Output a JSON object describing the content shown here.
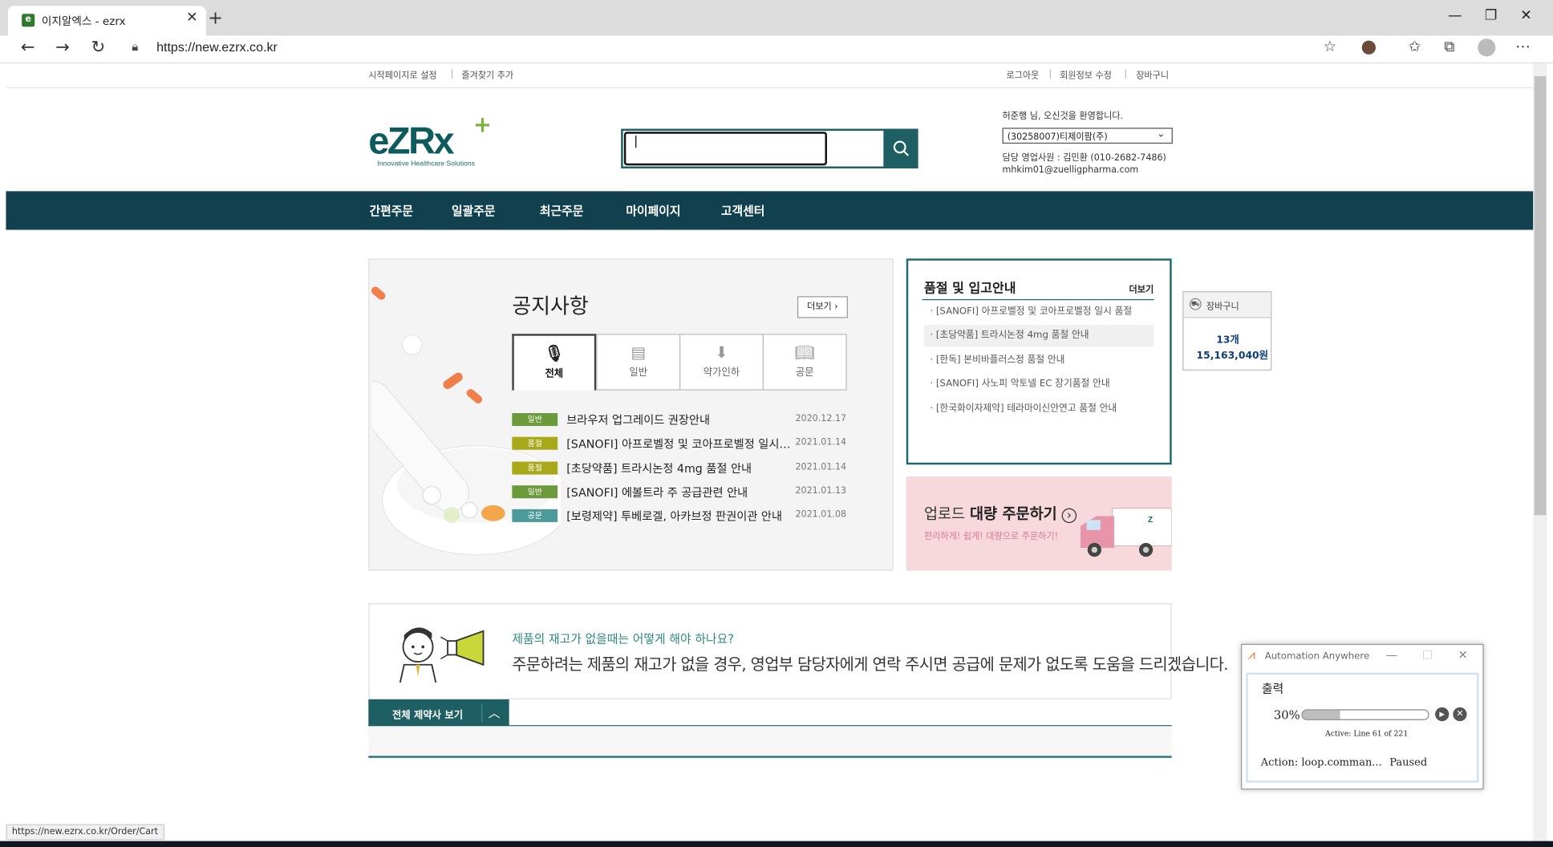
{
  "browser": {
    "tab_title": "이지알엑스 - ezrx",
    "url": "https://new.ezrx.co.kr"
  },
  "site": {
    "top_left_links": [
      "시작페이지로 설정",
      "즐겨찾기 추가"
    ],
    "top_right_links": [
      "로그아웃",
      "회원정보 수정",
      "장바구니"
    ],
    "logo_text": "eZRx",
    "logo_tagline": "Innovative Healthcare Solutions",
    "search": {
      "value": "|",
      "placeholder": ""
    },
    "welcome": "허준행 님, 오신것을 환영합니다.",
    "account_select": "(30258007)티제이팜(주)",
    "sales_rep": "담당 영업사원 : 김민환 (010-2682-7486)",
    "sales_email": "mhkim01@zuelligpharma.com",
    "gnb": [
      "간편주문",
      "일괄주문",
      "최근주문",
      "마이페이지",
      "고객센터"
    ]
  },
  "notice": {
    "title": "공지사항",
    "more": "더보기",
    "tabs": [
      {
        "label": "전체",
        "icon": "microphone-icon"
      },
      {
        "label": "일반",
        "icon": "calendar-icon"
      },
      {
        "label": "약가인하",
        "icon": "arrow-down-circle-icon"
      },
      {
        "label": "공문",
        "icon": "book-icon"
      }
    ],
    "items": [
      {
        "badge": "일반",
        "color": "#6a9a3a",
        "text": "브라우저 업그레이드 권장안내",
        "date": "2020.12.17"
      },
      {
        "badge": "품절",
        "color": "#a8a81a",
        "text": "[SANOFI] 아프로벨정 및 코아프로벨정 일시 품절",
        "date": "2021.01.14"
      },
      {
        "badge": "품절",
        "color": "#a8a81a",
        "text": "[초당약품] 트라시논정 4mg 품절 안내",
        "date": "2021.01.14"
      },
      {
        "badge": "일반",
        "color": "#6a9a3a",
        "text": "[SANOFI] 에볼트라 주 공급관련 안내",
        "date": "2021.01.13"
      },
      {
        "badge": "공문",
        "color": "#4d9a9a",
        "text": "[보령제약] 투베로겔, 아카브정 판권이관 안내",
        "date": "2021.01.08"
      }
    ]
  },
  "stock": {
    "title": "품절 및 입고안내",
    "more": "더보기",
    "items": [
      "· [SANOFI] 아프로벨정 및 코아프로벨정 일시 품절",
      "· [초당약품] 트라시논정 4mg 품절 안내",
      "· [한독] 본비바플러스정 품절 안내",
      "· [SANOFI] 사노피 악토넬 EC 장기품절 안내",
      "· [한국화이자제약] 테라마이신안연고 품절 안내"
    ]
  },
  "banner": {
    "title_plain": "업로드 ",
    "title_bold": "대량 주문하기",
    "arrow": "›",
    "subtitle": "편리하게! 쉽게! 대량으로 주문하기!"
  },
  "cart_widget": {
    "title": "장바구니",
    "count": "13개",
    "amount": "15,163,040원"
  },
  "info": {
    "question": "제품의 재고가 없을때는 어떻게 해야 하나요?",
    "answer": "주문하려는 제품의 재고가 없을 경우, 영업부 담당자에게 연락 주시면 공급에 문제가 없도록 도움을 드리겠습니다."
  },
  "all_companies_label": "전체 제약사 보기",
  "status_url": "https://new.ezrx.co.kr/Order/Cart",
  "automation": {
    "app": "Automation Anywhere",
    "output_label": "출력",
    "percent": "30%",
    "progress": 0.3,
    "active": "Active: Line 61 of 221",
    "action": "Action: loop.comman...",
    "state": "Paused"
  }
}
